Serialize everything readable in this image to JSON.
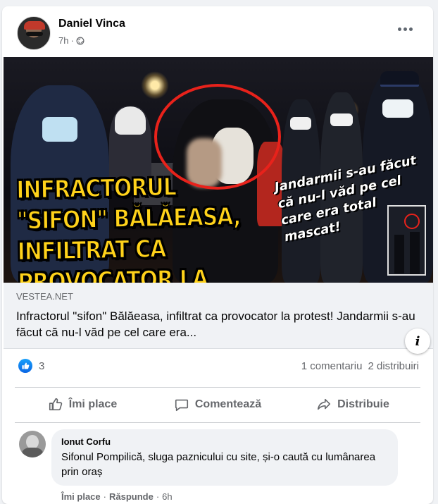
{
  "post": {
    "author": "Daniel Vinca",
    "time": "7h",
    "privacy_icon": "globe-icon",
    "more_icon": "more-horizontal-icon"
  },
  "media": {
    "overlay_title": "Infractorul \"sifon\" Bălăeasa, infiltrat ca provocator la protest!",
    "overlay_side": "Jandarmii s-au făcut că nu-l văd pe cel care era total mascat!",
    "info_label": "i",
    "highlight_color": "#e8221b",
    "title_color": "#ffd21a"
  },
  "link": {
    "domain": "VESTEA.NET",
    "title": "Infractorul \"sifon\" Bălăeasa, infiltrat ca provocator la protest! Jandarmii s-au făcut că nu-l văd pe cel care era..."
  },
  "stats": {
    "reaction_icon": "like-reaction-icon",
    "reaction_count": "3",
    "comments": "1 comentariu",
    "shares": "2 distribuiri"
  },
  "actions": {
    "like_label": "Îmi place",
    "comment_label": "Comentează",
    "share_label": "Distribuie"
  },
  "comment": {
    "author": "Ionut Corfu",
    "text": "Sifonul Pompilică, sluga paznicului cu site, și-o caută cu lumânarea prin oraș",
    "like_label": "Îmi place",
    "separator1": "·",
    "reply_label": "Răspunde",
    "separator2": "·",
    "time": "6h"
  },
  "colors": {
    "accent": "#1877f2",
    "secondary_text": "#65676b",
    "background": "#f0f2f5"
  }
}
